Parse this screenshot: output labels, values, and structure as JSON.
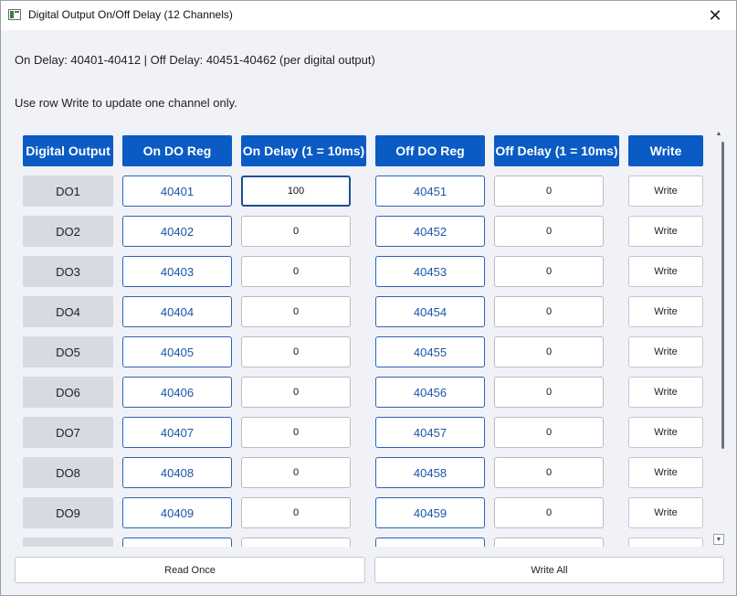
{
  "window": {
    "title": "Digital Output On/Off Delay (12 Channels)",
    "close_glyph": "✕"
  },
  "info": {
    "registers_line": "On Delay: 40401-40412 | Off Delay: 40451-40462 (per digital output)",
    "hint_line": "Use row Write to update one channel only."
  },
  "table": {
    "headers": {
      "digital_output": "Digital Output",
      "on_do_reg": "On DO Reg",
      "on_delay": "On Delay (1 = 10ms)",
      "off_do_reg": "Off DO Reg",
      "off_delay": "Off Delay (1 = 10ms)",
      "write": "Write"
    },
    "rows": [
      {
        "label": "DO1",
        "on_reg": "40401",
        "on_delay": "100",
        "off_reg": "40451",
        "off_delay": "0",
        "write": "Write"
      },
      {
        "label": "DO2",
        "on_reg": "40402",
        "on_delay": "0",
        "off_reg": "40452",
        "off_delay": "0",
        "write": "Write"
      },
      {
        "label": "DO3",
        "on_reg": "40403",
        "on_delay": "0",
        "off_reg": "40453",
        "off_delay": "0",
        "write": "Write"
      },
      {
        "label": "DO4",
        "on_reg": "40404",
        "on_delay": "0",
        "off_reg": "40454",
        "off_delay": "0",
        "write": "Write"
      },
      {
        "label": "DO5",
        "on_reg": "40405",
        "on_delay": "0",
        "off_reg": "40455",
        "off_delay": "0",
        "write": "Write"
      },
      {
        "label": "DO6",
        "on_reg": "40406",
        "on_delay": "0",
        "off_reg": "40456",
        "off_delay": "0",
        "write": "Write"
      },
      {
        "label": "DO7",
        "on_reg": "40407",
        "on_delay": "0",
        "off_reg": "40457",
        "off_delay": "0",
        "write": "Write"
      },
      {
        "label": "DO8",
        "on_reg": "40408",
        "on_delay": "0",
        "off_reg": "40458",
        "off_delay": "0",
        "write": "Write"
      },
      {
        "label": "DO9",
        "on_reg": "40409",
        "on_delay": "0",
        "off_reg": "40459",
        "off_delay": "0",
        "write": "Write"
      }
    ]
  },
  "scrollbar": {
    "up_glyph": "▲",
    "down_glyph": "▼"
  },
  "footer": {
    "read_once_label": "Read Once",
    "write_all_label": "Write All"
  },
  "colors": {
    "header_bg": "#0a5bc4",
    "register_text": "#1a56a8",
    "label_bg": "#d6dae1"
  }
}
